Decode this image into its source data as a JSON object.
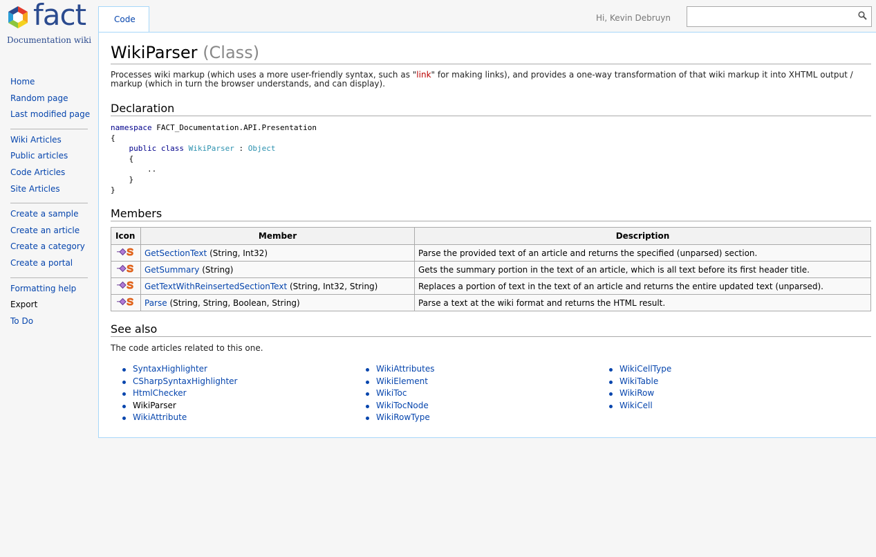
{
  "logo": {
    "text": "fact",
    "tagline": "Documentation wiki"
  },
  "sidebar": {
    "groups": [
      [
        {
          "label": "Home"
        },
        {
          "label": "Random page"
        },
        {
          "label": "Last modified page"
        }
      ],
      [
        {
          "label": "Wiki Articles"
        },
        {
          "label": "Public articles"
        },
        {
          "label": "Code Articles"
        },
        {
          "label": "Site Articles"
        }
      ],
      [
        {
          "label": "Create a sample"
        },
        {
          "label": "Create an article"
        },
        {
          "label": "Create a category"
        },
        {
          "label": "Create a portal"
        }
      ],
      [
        {
          "label": "Formatting help"
        },
        {
          "label": "Export"
        },
        {
          "label": "To Do"
        }
      ]
    ]
  },
  "tab": {
    "label": "Code"
  },
  "header": {
    "greeting": "Hi, Kevin Debruyn",
    "search_value": ""
  },
  "page": {
    "title": "WikiParser",
    "kind": "(Class)",
    "intro_before": "Processes wiki markup (which uses a more user-friendly syntax, such as \"",
    "intro_link": "link",
    "intro_after": "\" for making links), and provides a one-way transformation of that wiki markup it into XHTML output / markup (which in turn the browser understands, and can display).",
    "declaration_heading": "Declaration",
    "code": {
      "namespace_kw": "namespace",
      "namespace_name": "FACT_Documentation.API.Presentation",
      "open_brace": "{",
      "modifiers": "public class",
      "class_name": "WikiParser",
      "colon": ":",
      "base_class": "Object",
      "inner_open": "{",
      "ellipsis": "..",
      "inner_close": "}",
      "close_brace": "}"
    },
    "members_heading": "Members",
    "members_columns": {
      "icon": "Icon",
      "member": "Member",
      "description": "Description"
    },
    "members": [
      {
        "name": "GetSectionText",
        "params": "(String, Int32)",
        "description": "Parse the provided text of an article and returns the specified (unparsed) section."
      },
      {
        "name": "GetSummary",
        "params": "(String)",
        "description": "Gets the summary portion in the text of an article, which is all text before its first header title."
      },
      {
        "name": "GetTextWithReinsertedSectionText",
        "params": "(String, Int32, String)",
        "description": "Replaces a portion of text in the text of an article and returns the entire updated text (unparsed)."
      },
      {
        "name": "Parse",
        "params": "(String, String, Boolean, String)",
        "description": "Parse a text at the wiki format and returns the HTML result."
      }
    ],
    "see_also_heading": "See also",
    "see_also_intro": "The code articles related to this one.",
    "see_also": [
      [
        "SyntaxHighlighter",
        "CSharpSyntaxHighlighter",
        "HtmlChecker",
        "WikiParser",
        "WikiAttribute"
      ],
      [
        "WikiAttributes",
        "WikiElement",
        "WikiToc",
        "WikiTocNode",
        "WikiRowType"
      ],
      [
        "WikiCellType",
        "WikiTable",
        "WikiRow",
        "WikiCell"
      ]
    ]
  },
  "colors": {
    "link": "#0645ad",
    "new_link": "#ba0000",
    "border": "#a7d7f9",
    "brand": "#2b4b8f"
  }
}
